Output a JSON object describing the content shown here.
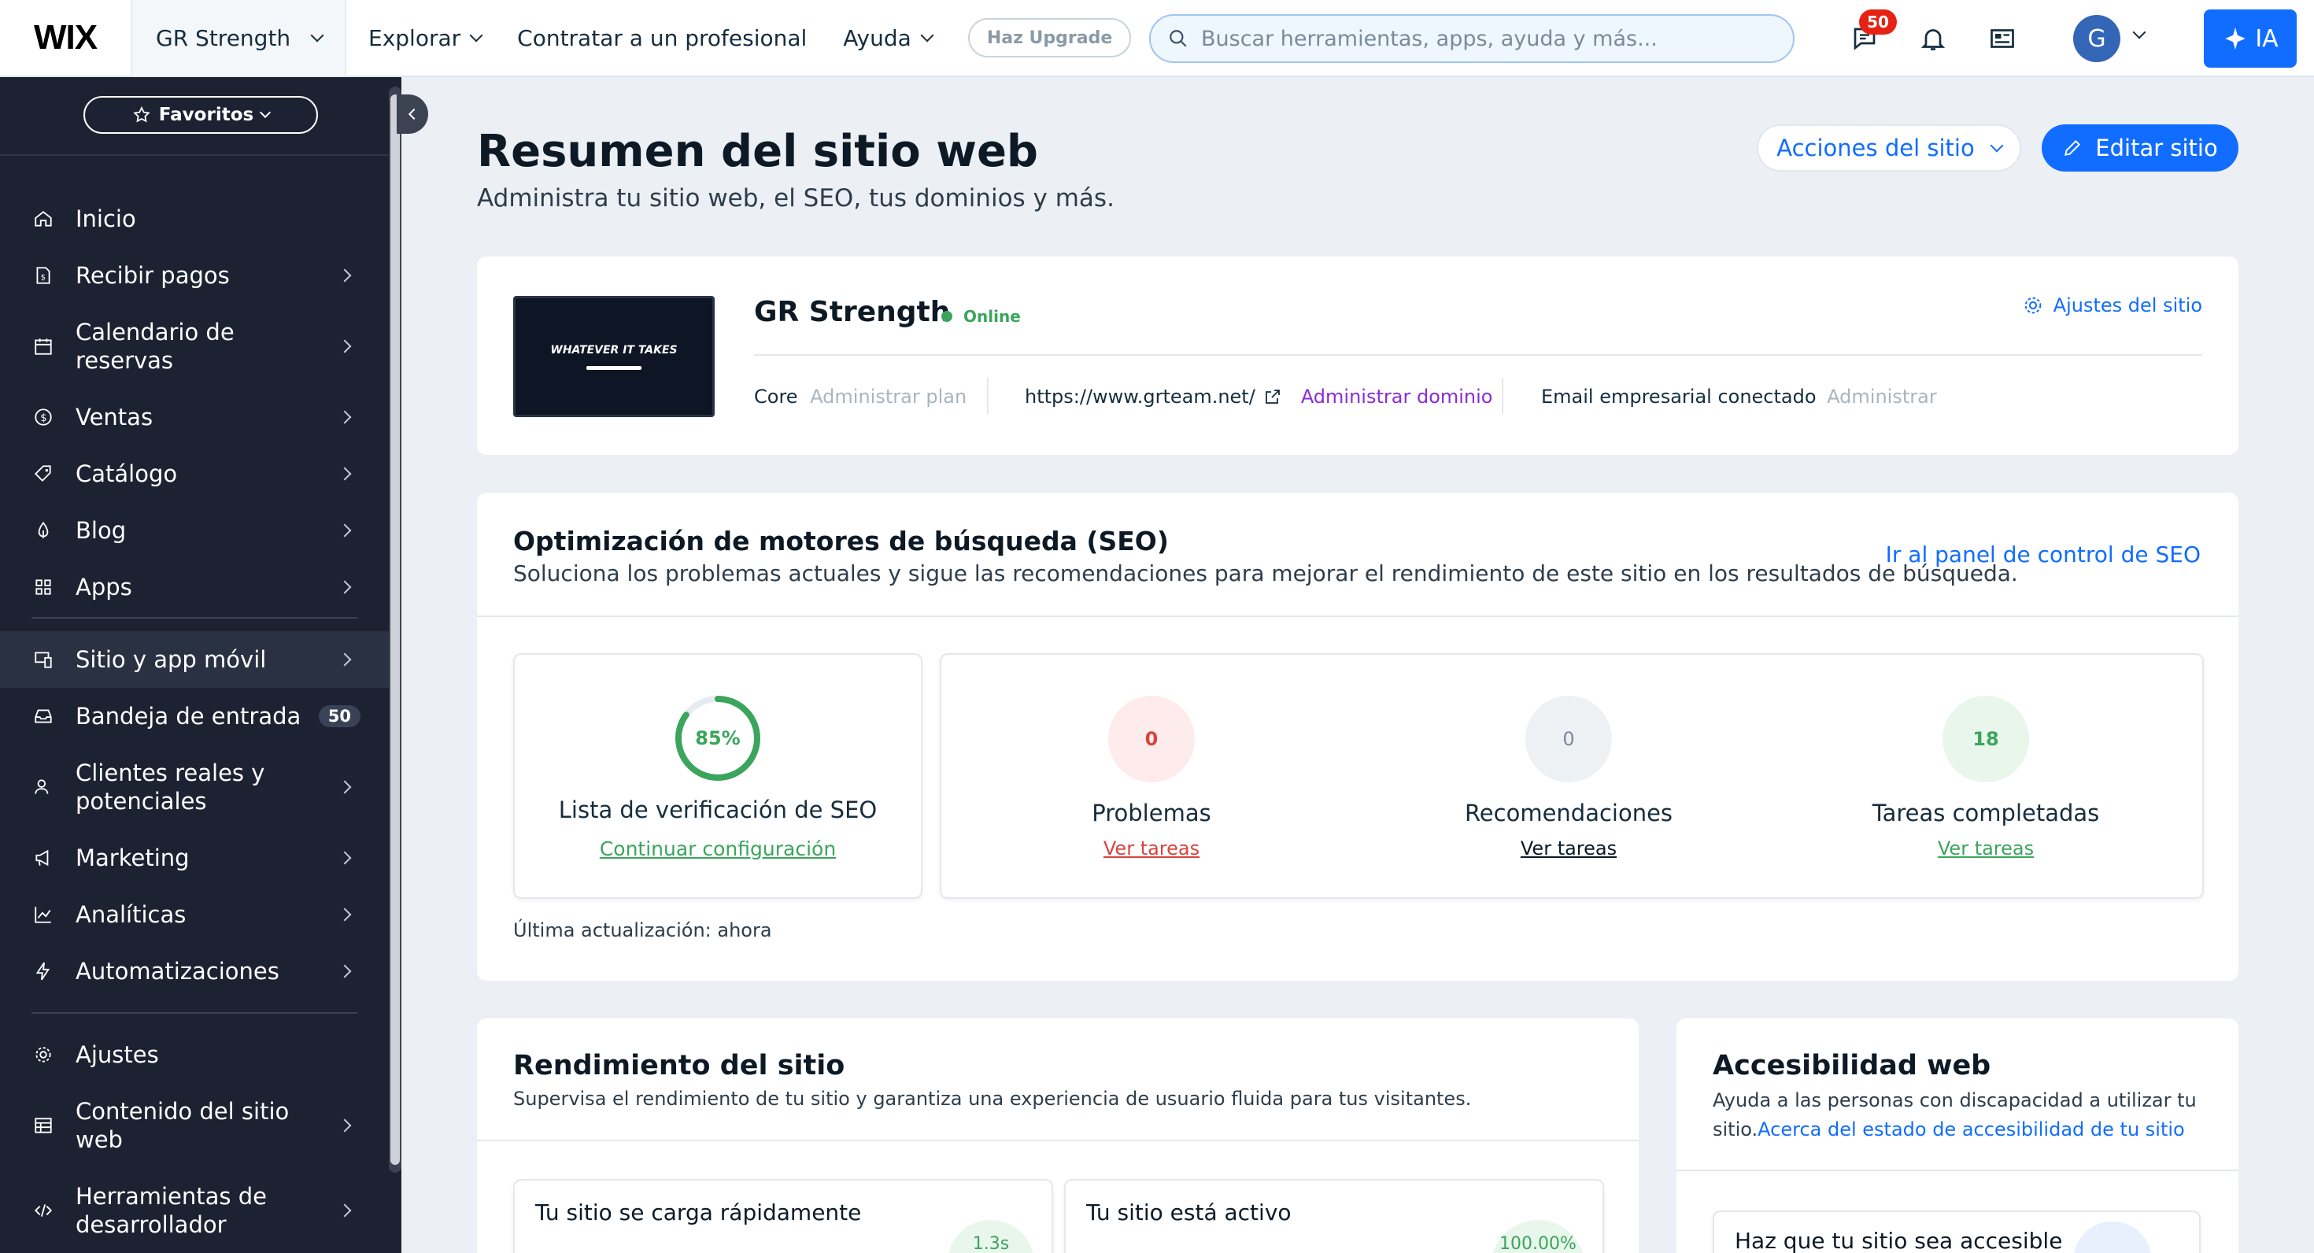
{
  "topbar": {
    "logo": "WIX",
    "site_name": "GR Strength",
    "nav": [
      "Explorar",
      "Contratar a un profesional",
      "Ayuda"
    ],
    "upgrade": "Haz Upgrade",
    "search_placeholder": "Buscar herramientas, apps, ayuda y más...",
    "chat_badge": "50",
    "avatar_letter": "G",
    "ai_label": "IA",
    "accent": "#116dff"
  },
  "sidebar": {
    "favorites": "Favoritos",
    "items": [
      {
        "label": "Inicio",
        "icon": "home-icon",
        "arrow": false
      },
      {
        "label": "Recibir pagos",
        "icon": "payments-icon",
        "arrow": true
      },
      {
        "label": "Calendario de reservas",
        "icon": "calendar-icon",
        "arrow": true
      },
      {
        "label": "Ventas",
        "icon": "dollar-icon",
        "arrow": true
      },
      {
        "label": "Catálogo",
        "icon": "tag-icon",
        "arrow": true
      },
      {
        "label": "Blog",
        "icon": "pen-icon",
        "arrow": true
      },
      {
        "label": "Apps",
        "icon": "apps-icon",
        "arrow": true
      },
      {
        "label": "Sitio y app móvil",
        "icon": "devices-icon",
        "arrow": true
      },
      {
        "label": "Bandeja de entrada",
        "icon": "inbox-icon",
        "badge": "50"
      },
      {
        "label": "Clientes reales y potenciales",
        "icon": "contacts-icon",
        "arrow": true
      },
      {
        "label": "Marketing",
        "icon": "megaphone-icon",
        "arrow": true
      },
      {
        "label": "Analíticas",
        "icon": "chart-icon",
        "arrow": true
      },
      {
        "label": "Automatizaciones",
        "icon": "bolt-icon",
        "arrow": true
      },
      {
        "label": "Ajustes",
        "icon": "gear-icon",
        "arrow": false
      },
      {
        "label": "Contenido del sitio web",
        "icon": "table-icon",
        "arrow": true
      },
      {
        "label": "Herramientas de desarrollador",
        "icon": "code-icon",
        "arrow": true
      }
    ]
  },
  "header": {
    "title": "Resumen del sitio web",
    "subtitle": "Administra tu sitio web, el SEO, tus dominios y más.",
    "site_actions": "Acciones del sitio",
    "edit_site": "Editar sitio"
  },
  "site_card": {
    "thumbnail_text": "WHATEVER IT TAKES",
    "name": "GR Strength",
    "status": "Online",
    "settings_link": "Ajustes del sitio",
    "plan": "Core",
    "plan_link": "Administrar plan",
    "url": "https://www.grteam.net/",
    "domain_link": "Administrar dominio",
    "email": "Email empresarial conectado",
    "email_link": "Administrar"
  },
  "seo": {
    "title": "Optimización de motores de búsqueda (SEO)",
    "subtitle": "Soluciona los problemas actuales y sigue las recomendaciones para mejorar el rendimiento de este sitio en los resultados de búsqueda.",
    "panel_link": "Ir al panel de control de SEO",
    "checklist_percent": "85%",
    "checklist_value": 0.85,
    "checklist_label": "Lista de verificación de SEO",
    "checklist_link": "Continuar configuración",
    "stats": [
      {
        "value": "0",
        "label": "Problemas",
        "link": "Ver tareas",
        "color": "#d6453d"
      },
      {
        "value": "0",
        "label": "Recomendaciones",
        "link": "Ver tareas",
        "color": "#7a8a99"
      },
      {
        "value": "18",
        "label": "Tareas completadas",
        "link": "Ver tareas",
        "color": "#3ba55c"
      }
    ],
    "updated": "Última actualización: ahora"
  },
  "performance": {
    "title": "Rendimiento del sitio",
    "subtitle": "Supervisa el rendimiento de tu sitio y garantiza una experiencia de usuario fluida para tus visitantes.",
    "card1_title": "Tu sitio se carga rápidamente",
    "card1_value": "1.3s",
    "card2_title": "Tu sitio está activo",
    "card2_value": "100.00%"
  },
  "accessibility": {
    "title": "Accesibilidad web",
    "subtitle": "Ayuda a las personas con discapacidad a utilizar tu sitio.",
    "link": "Acerca del estado de accesibilidad de tu sitio",
    "card_title": "Haz que tu sitio sea accesible"
  }
}
